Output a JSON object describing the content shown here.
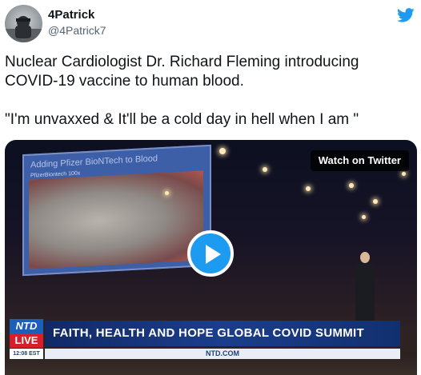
{
  "author": {
    "name": "4Patrick",
    "handle": "@4Patrick7"
  },
  "tweet": {
    "paragraphs": [
      "Nuclear Cardiologist Dr. Richard Fleming introducing COVID-19 vaccine to human blood.",
      "\"I'm unvaxxed & It'll be a cold day in hell when I am \""
    ]
  },
  "media": {
    "watch_label": "Watch on Twitter",
    "slide_title": "Adding Pfizer BioNTech to Blood",
    "slide_subtitle": "PfizerBiontech 100x",
    "channel": "NTD",
    "live": "LIVE",
    "time": "12:08 EST",
    "headline": "FAITH, HEALTH AND HOPE GLOBAL COVID SUMMIT",
    "url": "NTD.COM"
  },
  "colors": {
    "twitter_blue": "#1d9bf0",
    "live_red": "#d3202a",
    "ntd_blue": "#1c5fb8"
  },
  "icons": {
    "logo": "twitter-bird-icon",
    "play": "play-icon"
  }
}
